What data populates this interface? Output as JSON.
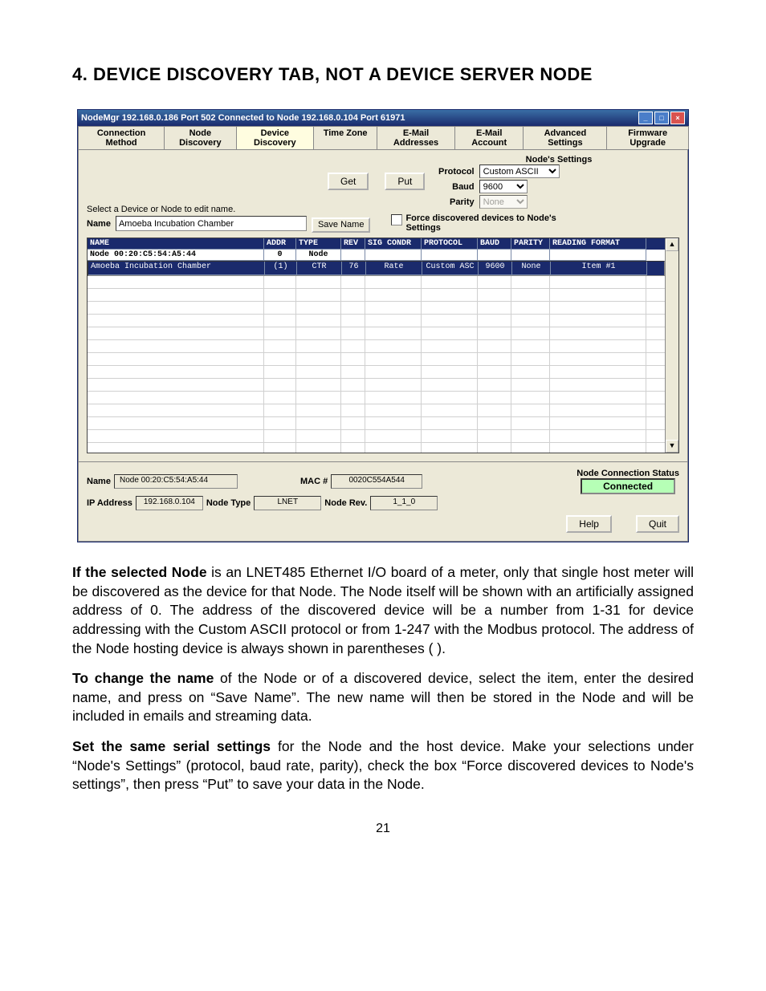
{
  "heading": "4.  DEVICE DISCOVERY TAB, NOT A DEVICE SERVER NODE",
  "titlebar": "NodeMgr  192.168.0.186  Port 502   Connected to  Node  192.168.0.104  Port 61971",
  "tabs": [
    "Connection Method",
    "Node Discovery",
    "Device Discovery",
    "Time Zone",
    "E-Mail Addresses",
    "E-Mail Account",
    "Advanced Settings",
    "Firmware Upgrade"
  ],
  "active_tab_index": 2,
  "panel": {
    "get": "Get",
    "put": "Put",
    "select_hint": "Select a Device or Node to edit name.",
    "name_lbl": "Name",
    "name_val": "Amoeba Incubation Chamber",
    "save_name": "Save Name"
  },
  "node_settings": {
    "header": "Node's Settings",
    "protocol_lbl": "Protocol",
    "protocol_val": "Custom ASCII",
    "baud_lbl": "Baud",
    "baud_val": "9600",
    "parity_lbl": "Parity",
    "parity_val": "None",
    "force_lbl": "Force discovered devices to Node's Settings"
  },
  "table": {
    "headers": [
      "NAME",
      "ADDR",
      "TYPE",
      "REV",
      "SIG CONDR",
      "PROTOCOL",
      "BAUD",
      "PARITY",
      "READING FORMAT"
    ],
    "rows": [
      {
        "name": "Node 00:20:C5:54:A5:44",
        "addr": "0",
        "type": "Node",
        "rev": "",
        "sig": "",
        "proto": "",
        "baud": "",
        "parity": "",
        "fmt": "",
        "cls": "node"
      },
      {
        "name": "Amoeba Incubation Chamber",
        "addr": "(1)",
        "type": "CTR",
        "rev": "76",
        "sig": "Rate",
        "proto": "Custom ASC",
        "baud": "9600",
        "parity": "None",
        "fmt": "Item #1",
        "cls": "sel"
      }
    ]
  },
  "status": {
    "name_lbl": "Name",
    "name_val": "Node 00:20:C5:54:A5:44",
    "mac_lbl": "MAC #",
    "mac_val": "0020C554A544",
    "ip_lbl": "IP Address",
    "ip_val": "192.168.0.104",
    "type_lbl": "Node Type",
    "type_val": "LNET",
    "rev_lbl": "Node Rev.",
    "rev_val": "1_1_0",
    "conn_title": "Node Connection Status",
    "conn_val": "Connected",
    "help": "Help",
    "quit": "Quit"
  },
  "paragraphs": {
    "p1_b": "If the selected Node",
    "p1": " is an LNET485 Ethernet I/O board of a meter, only that single host meter will be discovered as the device for that Node. The Node itself will be shown with an artificially assigned address of 0. The address of the discovered device will be a number from 1-31 for device addressing with the Custom ASCII protocol or from 1-247 with the Modbus protocol. The address of the Node hosting device is always shown in parentheses ( ).",
    "p2_b": "To change the name",
    "p2": " of the Node or of a discovered device, select the item, enter the desired name, and press on “Save Name”. The new name will then be stored in the Node and will be included in emails and streaming data.",
    "p3_b": "Set the same serial settings",
    "p3": " for the Node and the host device. Make your selections under “Node's Settings” (protocol, baud rate, parity), check the box “Force discovered devices to Node's settings”, then press “Put” to save your data in the Node."
  },
  "page_num": "21"
}
